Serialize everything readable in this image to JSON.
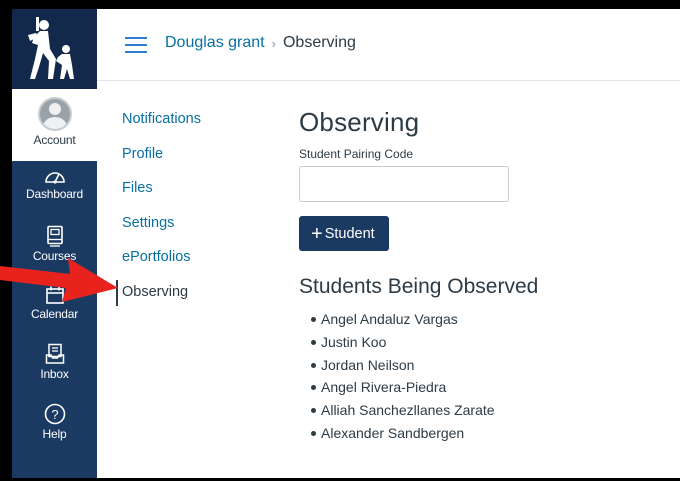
{
  "nav": {
    "items": [
      {
        "label": "Account",
        "icon": "avatar-icon"
      },
      {
        "label": "Dashboard",
        "icon": "dashboard-icon"
      },
      {
        "label": "Courses",
        "icon": "courses-icon"
      },
      {
        "label": "Calendar",
        "icon": "calendar-icon"
      },
      {
        "label": "Inbox",
        "icon": "inbox-icon"
      },
      {
        "label": "Help",
        "icon": "help-icon"
      }
    ]
  },
  "header": {
    "breadcrumb_user": "Douglas grant",
    "breadcrumb_separator": "›",
    "breadcrumb_current": "Observing"
  },
  "settings_nav": {
    "items": [
      "Notifications",
      "Profile",
      "Files",
      "Settings",
      "ePortfolios",
      "Observing"
    ],
    "active": "Observing"
  },
  "main": {
    "title": "Observing",
    "pairing_label": "Student Pairing Code",
    "pairing_value": "",
    "add_button_label": "Student",
    "section_title": "Students Being Observed",
    "students": [
      "Angel Andaluz Vargas",
      "Justin Koo",
      "Jordan Neilson",
      "Angel Rivera-Piedra",
      "Alliah Sanchezllanes Zarate",
      "Alexander Sandbergen"
    ]
  },
  "colors": {
    "nav_bg": "#1b3a62",
    "link": "#0770a3",
    "button_bg": "#1b3a62",
    "annotation_arrow": "#e8231e"
  }
}
